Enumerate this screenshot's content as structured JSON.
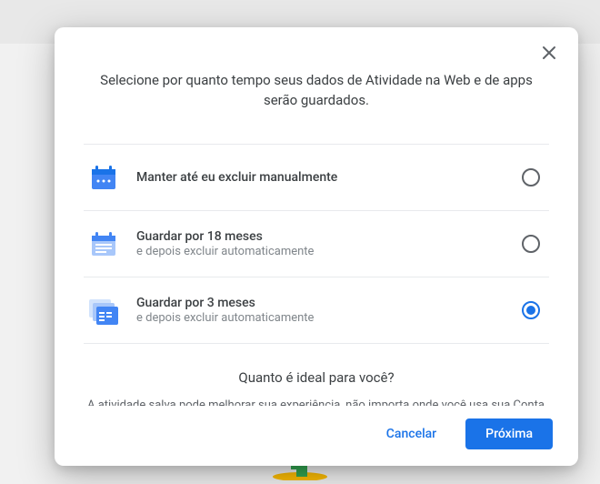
{
  "header": {
    "subtitle": "Selecione por quanto tempo seus dados de Atividade na Web e de apps serão guardados."
  },
  "options": [
    {
      "title": "Manter até eu excluir manualmente",
      "sub": "",
      "selected": false,
      "icon": "calendar-dots"
    },
    {
      "title": "Guardar por 18 meses",
      "sub": "e depois excluir automaticamente",
      "selected": false,
      "icon": "calendar-lines"
    },
    {
      "title": "Guardar por 3 meses",
      "sub": "e depois excluir automaticamente",
      "selected": true,
      "icon": "calendar-stack"
    }
  ],
  "info": {
    "title": "Quanto é ideal para você?",
    "body": "A atividade salva pode melhorar sua experiência, não importa onde você usa sua Conta do Google. O que você pesquisa, lê e assiste pode ser usado para ajudar você a fazer mais em menos tempo, como descobrir conteúdo novo e continuar de onde parou."
  },
  "footer": {
    "cancel": "Cancelar",
    "next": "Próxima"
  }
}
